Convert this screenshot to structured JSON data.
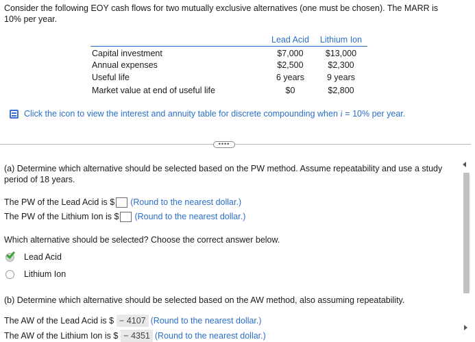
{
  "intro": "Consider the following EOY cash flows for two mutually exclusive alternatives (one must be chosen). The MARR is 10% per year.",
  "table": {
    "headers": [
      "Lead Acid",
      "Lithium Ion"
    ],
    "rows": [
      {
        "label": "Capital investment",
        "lead": "$7,000",
        "lithium": "$13,000"
      },
      {
        "label": "Annual expenses",
        "lead": "$2,500",
        "lithium": "$2,300"
      },
      {
        "label": "Useful life",
        "lead": "6 years",
        "lithium": "9 years"
      },
      {
        "label": "Market value at end of useful life",
        "lead": "$0",
        "lithium": "$2,800"
      }
    ]
  },
  "icon_link": {
    "text_before": "Click the icon to view the interest and annuity table for discrete compounding when ",
    "var": "i",
    "text_after": " = 10% per year."
  },
  "more_button": "••••",
  "part_a": {
    "question": "(a) Determine which alternative should be selected based on the PW method. Assume repeatability and use a study period of 18 years.",
    "pw_lead_prefix": "The PW of the Lead Acid is $",
    "pw_lithium_prefix": "The PW of the Lithium Ion is $",
    "round_hint": "(Round to the nearest dollar.)",
    "choose_prompt": "Which alternative should be selected? Choose the correct answer below.",
    "options": [
      "Lead Acid",
      "Lithium Ion"
    ]
  },
  "part_b": {
    "question": "(b) Determine which alternative should be selected based on the AW method, also assuming repeatability.",
    "aw_lead_prefix": "The AW of the Lead Acid is $",
    "aw_lead_value": "− 4107",
    "aw_lithium_prefix": "The AW of the Lithium Ion is $",
    "aw_lithium_value": "− 4351",
    "round_hint": "(Round to the nearest dollar.)"
  },
  "colors": {
    "accent": "#2a6fc9",
    "check": "#3aa535"
  },
  "icons": {
    "table_icon": "book-icon",
    "correct_mark": "checkmark-icon"
  }
}
